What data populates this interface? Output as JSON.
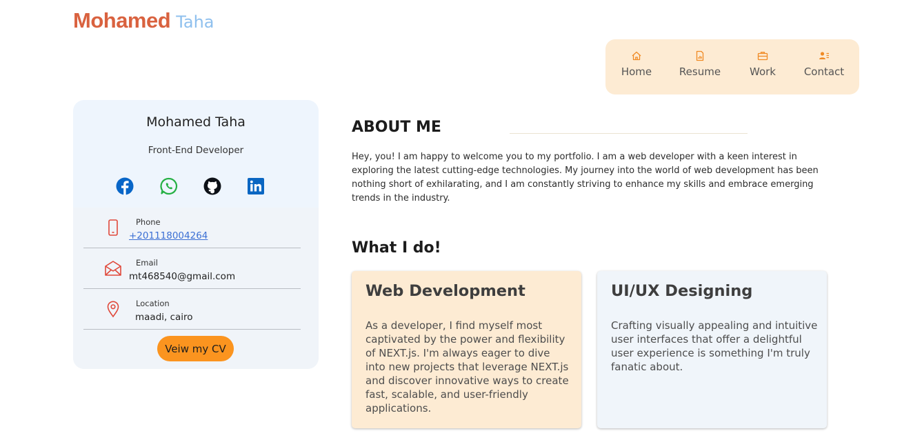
{
  "brand": {
    "first": "Mohamed",
    "last": "Taha"
  },
  "nav": {
    "items": [
      {
        "label": "Home",
        "icon": "home-icon"
      },
      {
        "label": "Resume",
        "icon": "document-chart-icon"
      },
      {
        "label": "Work",
        "icon": "briefcase-icon"
      },
      {
        "label": "Contact",
        "icon": "contact-card-icon"
      }
    ]
  },
  "profile": {
    "name": "Mohamed Taha",
    "role": "Front-End Developer",
    "social": [
      "facebook-icon",
      "whatsapp-icon",
      "github-icon",
      "linkedin-icon"
    ],
    "contacts": [
      {
        "label": "Phone",
        "value": "+201118004264",
        "icon": "phone-icon"
      },
      {
        "label": "Email",
        "value": "mt468540@gmail.com",
        "icon": "mail-icon"
      },
      {
        "label": "Location",
        "value": "maadi, cairo",
        "icon": "location-pin-icon"
      }
    ],
    "cv_button": "Veiw my CV"
  },
  "about": {
    "title": "ABOUT ME",
    "text": "Hey, you! I am happy to welcome you to my portfolio. I am a web developer with a keen interest in exploring the latest cutting-edge technologies. My journey into the world of web development has been nothing short of exhilarating, and I am constantly striving to enhance my skills and embrace emerging trends in the industry."
  },
  "whatido": {
    "title": "What I do!",
    "cards": [
      {
        "title": "Web Development",
        "text": "As a developer, I find myself most captivated by the power and flexibility of NEXT.js. I'm always eager to dive into new projects that leverage NEXT.js and discover innovative ways to create fast, scalable, and user-friendly applications."
      },
      {
        "title": "UI/UX Designing",
        "text": "Crafting visually appealing and intuitive user interfaces that offer a delightful user experience is something I'm truly fanatic about."
      }
    ]
  },
  "colors": {
    "brand_first": "#d9623f",
    "brand_last": "#8fc0ee",
    "nav_bg": "#fdebd3",
    "accent_orange": "#fb941f",
    "card_orange_bg": "#fdebd3",
    "card_blue_bg": "#f0f5fa",
    "profile_bg": "#eef5fd",
    "icon_red": "#e0483a"
  }
}
